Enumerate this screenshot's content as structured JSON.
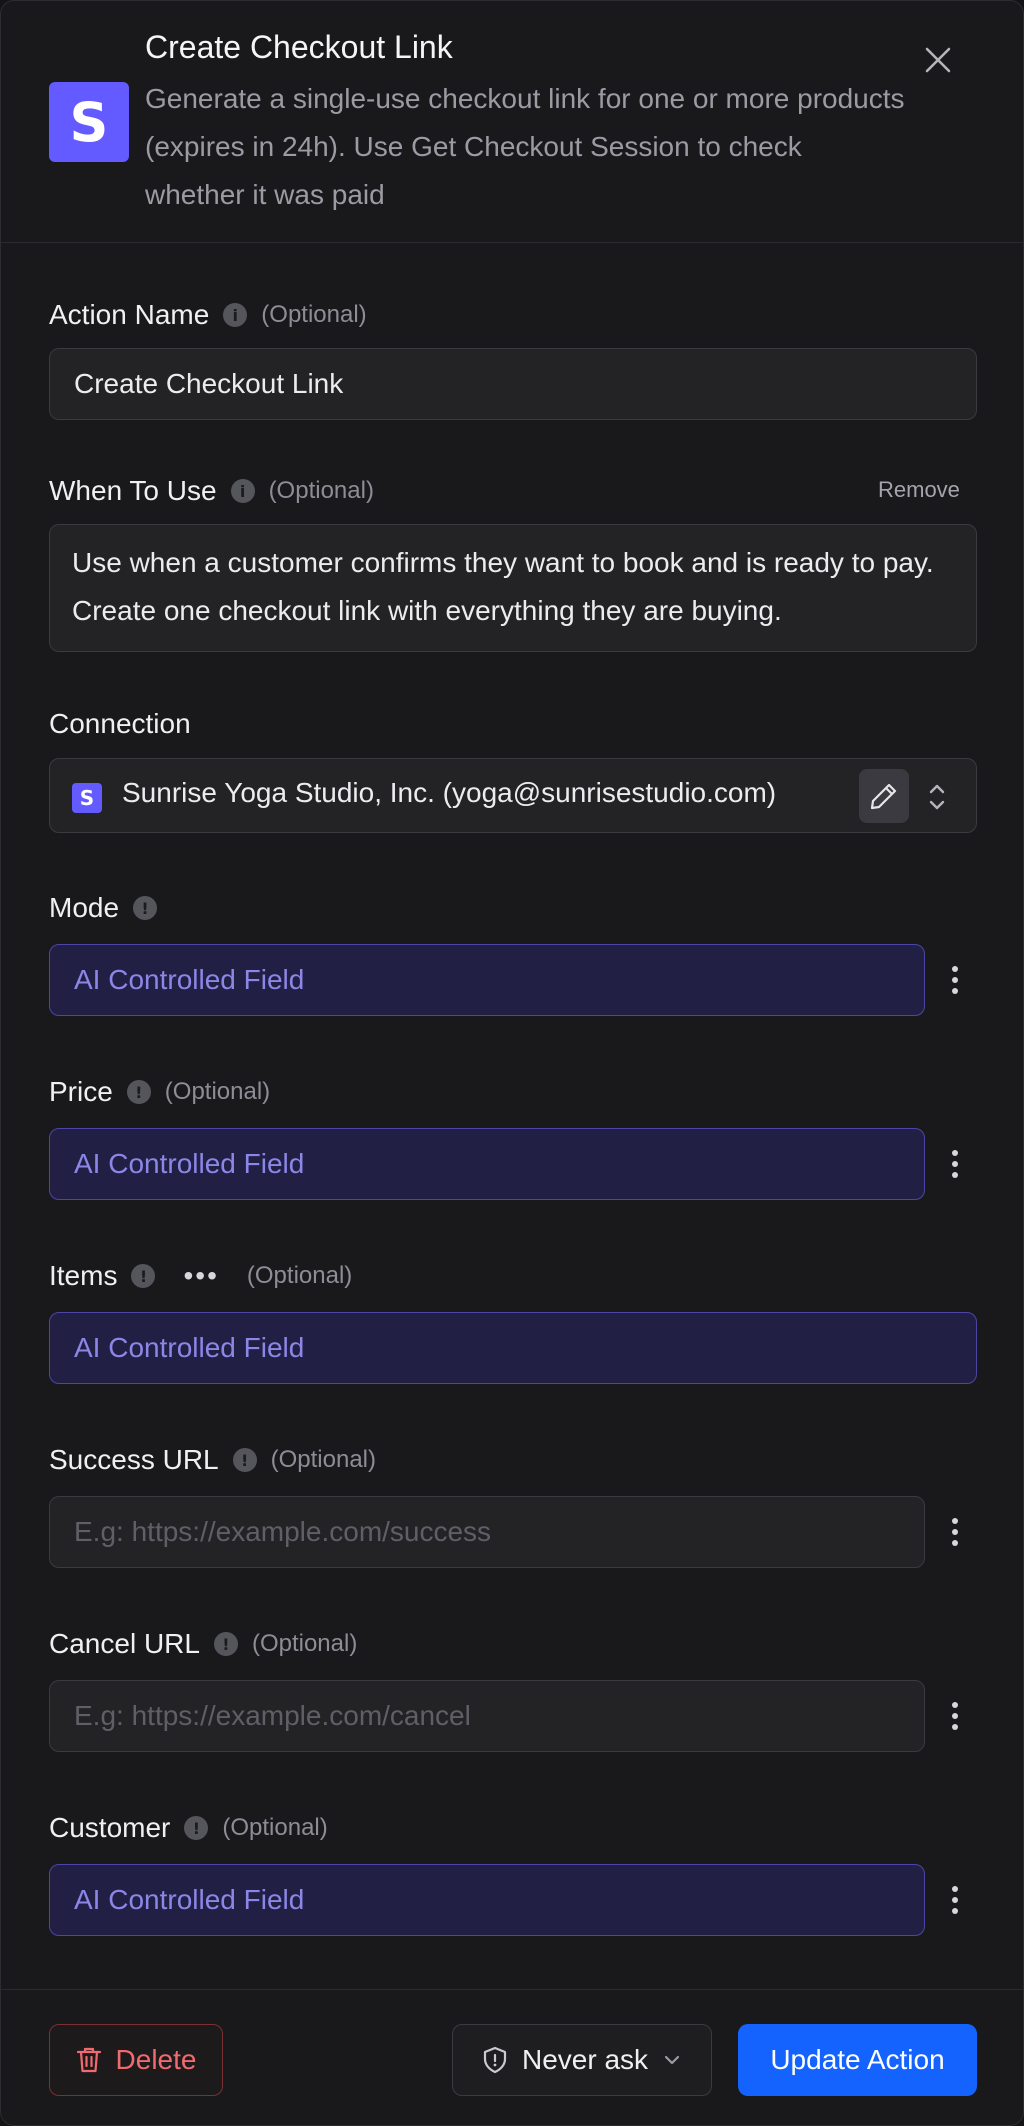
{
  "header": {
    "title": "Create Checkout Link",
    "description": "Generate a single-use checkout link for one or more products (expires in 24h). Use Get Checkout Session to check whether it was paid",
    "logo_letter": "S",
    "brand_color": "#635bff"
  },
  "optional_text": "(Optional)",
  "fields": {
    "action_name": {
      "label": "Action Name",
      "value": "Create Checkout Link"
    },
    "when_to_use": {
      "label": "When To Use",
      "remove_label": "Remove",
      "value": "Use when a customer confirms they want to book and is ready to pay. Create one checkout link with everything they are buying."
    },
    "connection": {
      "label": "Connection",
      "value": "Sunrise Yoga Studio, Inc. (yoga@sunrisestudio.com)",
      "logo_letter": "S"
    },
    "mode": {
      "label": "Mode",
      "value": "AI Controlled Field"
    },
    "price": {
      "label": "Price",
      "value": "AI Controlled Field"
    },
    "items": {
      "label": "Items",
      "value": "AI Controlled Field"
    },
    "success_url": {
      "label": "Success URL",
      "placeholder": "E.g: https://example.com/success"
    },
    "cancel_url": {
      "label": "Cancel URL",
      "placeholder": "E.g: https://example.com/cancel"
    },
    "customer": {
      "label": "Customer",
      "value": "AI Controlled Field"
    }
  },
  "footer": {
    "delete_label": "Delete",
    "approval_label": "Never ask",
    "submit_label": "Update Action",
    "accent_color": "#1463ff",
    "danger_color": "#f06a6f"
  },
  "icons": {
    "close": "close-icon",
    "info": "info-icon",
    "edit": "pencil-icon",
    "stepper": "chevron-up-down-icon",
    "more": "more-vertical-icon",
    "trash": "trash-icon",
    "shield": "shield-icon",
    "chevron": "chevron-down-icon"
  }
}
